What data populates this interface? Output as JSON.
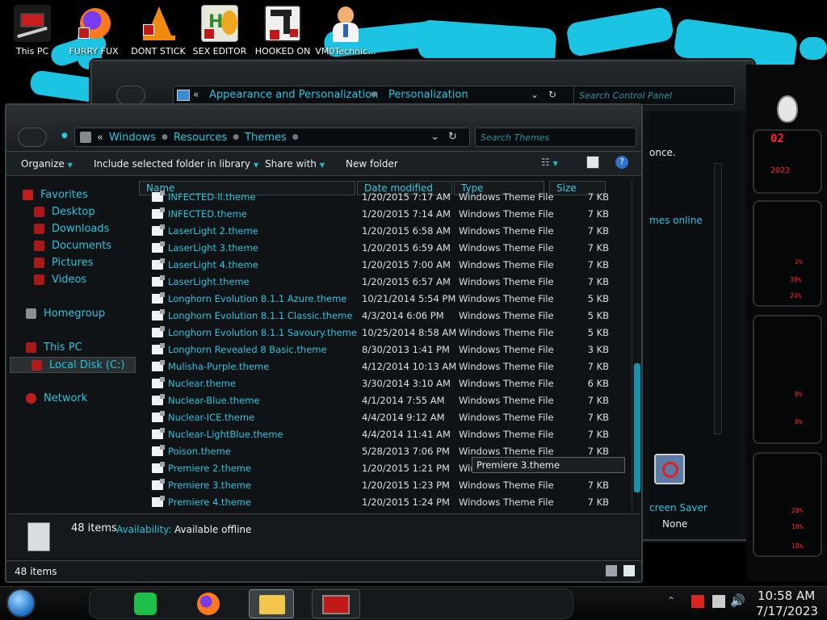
{
  "desktop": {
    "icons": [
      {
        "label": "This PC",
        "icon": "this-pc-icon"
      },
      {
        "label": "FURRY FUX",
        "icon": "firefox-icon"
      },
      {
        "label": "DONT STICK",
        "icon": "vlc-icon"
      },
      {
        "label": "SEX EDITOR",
        "icon": "hex-editor-icon"
      },
      {
        "label": "HOOKED ON",
        "icon": "hooked-on-icon"
      },
      {
        "label": "VM0Technic...",
        "icon": "doctor-icon"
      }
    ]
  },
  "bg_window": {
    "breadcrumb": [
      "Appearance and Personalization",
      "Personalization"
    ],
    "search_placeholder": "Search Control Panel",
    "right_text_1": "once.",
    "right_text_2": "mes online",
    "screen_saver_label": "creen Saver",
    "screen_saver_value": "None"
  },
  "explorer": {
    "breadcrumb": [
      "Windows",
      "Resources",
      "Themes"
    ],
    "search_placeholder": "Search Themes",
    "toolbar": {
      "organize": "Organize",
      "include": "Include selected folder in library",
      "share": "Share with",
      "new_folder": "New folder"
    },
    "nav": {
      "favorites": "Favorites",
      "desktop": "Desktop",
      "downloads": "Downloads",
      "documents": "Documents",
      "pictures": "Pictures",
      "videos": "Videos",
      "homegroup": "Homegroup",
      "this_pc": "This PC",
      "local_disk": "Local Disk (C:)",
      "network": "Network"
    },
    "columns": {
      "name": "Name",
      "date": "Date modified",
      "type": "Type",
      "size": "Size"
    },
    "partial_row": {
      "name": "INFECTED-ll.theme",
      "date": "1/20/2015 7:17 AM",
      "type": "Windows Theme File",
      "size": "7 KB"
    },
    "files": [
      {
        "name": "INFECTED.theme",
        "date": "1/20/2015 7:14 AM",
        "type": "Windows Theme File",
        "size": "7 KB"
      },
      {
        "name": "LaserLight 2.theme",
        "date": "1/20/2015 6:58 AM",
        "type": "Windows Theme File",
        "size": "7 KB"
      },
      {
        "name": "LaserLight 3.theme",
        "date": "1/20/2015 6:59 AM",
        "type": "Windows Theme File",
        "size": "7 KB"
      },
      {
        "name": "LaserLight 4.theme",
        "date": "1/20/2015 7:00 AM",
        "type": "Windows Theme File",
        "size": "7 KB"
      },
      {
        "name": "LaserLight.theme",
        "date": "1/20/2015 6:57 AM",
        "type": "Windows Theme File",
        "size": "7 KB"
      },
      {
        "name": "Longhorn Evolution 8.1.1 Azure.theme",
        "date": "10/21/2014 5:54 PM",
        "type": "Windows Theme File",
        "size": "5 KB"
      },
      {
        "name": "Longhorn Evolution 8.1.1 Classic.theme",
        "date": "4/3/2014 6:06 PM",
        "type": "Windows Theme File",
        "size": "5 KB"
      },
      {
        "name": "Longhorn Evolution 8.1.1 Savoury.theme",
        "date": "10/25/2014 8:58 AM",
        "type": "Windows Theme File",
        "size": "5 KB"
      },
      {
        "name": "Longhorn Revealed 8 Basic.theme",
        "date": "8/30/2013 1:41 PM",
        "type": "Windows Theme File",
        "size": "3 KB"
      },
      {
        "name": "Mulisha-Purple.theme",
        "date": "4/12/2014 10:13 AM",
        "type": "Windows Theme File",
        "size": "7 KB"
      },
      {
        "name": "Nuclear.theme",
        "date": "3/30/2014 3:10 AM",
        "type": "Windows Theme File",
        "size": "6 KB"
      },
      {
        "name": "Nuclear-Blue.theme",
        "date": "4/1/2014 7:55 AM",
        "type": "Windows Theme File",
        "size": "7 KB"
      },
      {
        "name": "Nuclear-ICE.theme",
        "date": "4/4/2014 9:12 AM",
        "type": "Windows Theme File",
        "size": "7 KB"
      },
      {
        "name": "Nuclear-LightBlue.theme",
        "date": "4/4/2014 11:41 AM",
        "type": "Windows Theme File",
        "size": "7 KB"
      },
      {
        "name": "Poison.theme",
        "date": "5/28/2013 7:06 PM",
        "type": "Windows Theme File",
        "size": "7 KB"
      },
      {
        "name": "Premiere 2.theme",
        "date": "1/20/2015 1:21 PM",
        "type": "Windows Theme File",
        "size": "7 KB"
      },
      {
        "name": "Premiere 3.theme",
        "date": "1/20/2015 1:23 PM",
        "type": "Windows Theme File",
        "size": "7 KB"
      },
      {
        "name": "Premiere 4.theme",
        "date": "1/20/2015 1:24 PM",
        "type": "Windows Theme File",
        "size": "7 KB"
      }
    ],
    "tooltip": "Premiere 3.theme",
    "details": {
      "count": "48 items",
      "availability_label": "Availability:",
      "availability_value": "Available offline"
    },
    "status_count": "48 items"
  },
  "gadget": {
    "percents": [
      "2%",
      "38%",
      "24%",
      "0%",
      "0%",
      "28%",
      "16%",
      "18%"
    ],
    "header_code": "2023"
  },
  "taskbar": {
    "time": "10:58 AM",
    "date": "7/17/2023"
  },
  "colors": {
    "accent": "#28c6e0",
    "wallpaper_stroke": "#1cc4e4",
    "gadget_red": "#ff2323"
  }
}
